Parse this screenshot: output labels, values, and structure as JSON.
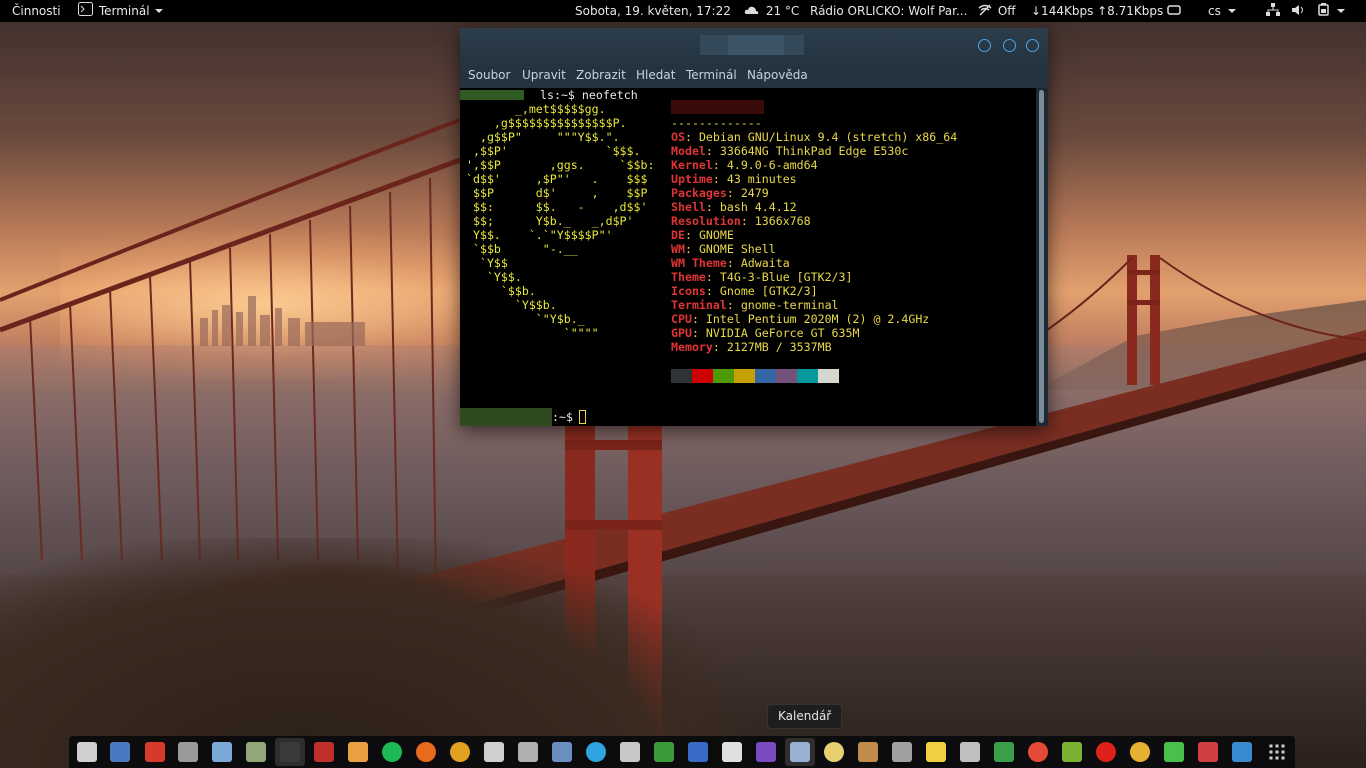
{
  "topbar": {
    "activities": "Činnosti",
    "app_menu": "Terminál",
    "clock": "Sobota, 19. květen, 17:22",
    "weather": "21 °C",
    "radio": "Rádio ORLICKO: Wolf Par...",
    "vpn": "Off",
    "netspeed": "↓144Kbps ↑8.71Kbps",
    "keyboard": "cs",
    "icons": [
      "terminal-icon",
      "chevron-down-icon",
      "cloud-sun-icon",
      "no-wifi-icon",
      "screen-icon",
      "network-icon",
      "volume-icon",
      "battery-icon",
      "power-menu-icon"
    ]
  },
  "terminal": {
    "menu": [
      "Soubor",
      "Upravit",
      "Zobrazit",
      "Hledat",
      "Terminál",
      "Nápověda"
    ],
    "command_line": "ls:~$ neofetch",
    "logo_lines": [
      "       _,met$$$$$gg.",
      "    ,g$$$$$$$$$$$$$$$P.",
      "  ,g$$P\"     \"\"\"Y$$.\".",
      " ,$$P'              `$$$.",
      "',$$P       ,ggs.     `$$b:",
      "`d$$'     ,$P\"'   .    $$$",
      " $$P      d$'     ,    $$P",
      " $$:      $$.   -    ,d$$'",
      " $$;      Y$b._   _,d$P'",
      " Y$$.    `.`\"Y$$$$P\"'",
      " `$$b      \"-.__",
      "  `Y$$",
      "   `Y$$.",
      "     `$$b.",
      "       `Y$$b.",
      "          `\"Y$b._",
      "              `\"\"\"\""
    ],
    "separator": "-------------",
    "info": [
      {
        "key": "OS",
        "value": "Debian GNU/Linux 9.4 (stretch) x86_64"
      },
      {
        "key": "Model",
        "value": "33664NG ThinkPad Edge E530c"
      },
      {
        "key": "Kernel",
        "value": "4.9.0-6-amd64"
      },
      {
        "key": "Uptime",
        "value": "43 minutes"
      },
      {
        "key": "Packages",
        "value": "2479"
      },
      {
        "key": "Shell",
        "value": "bash 4.4.12"
      },
      {
        "key": "Resolution",
        "value": "1366x768"
      },
      {
        "key": "DE",
        "value": "GNOME"
      },
      {
        "key": "WM",
        "value": "GNOME Shell"
      },
      {
        "key": "WM Theme",
        "value": "Adwaita"
      },
      {
        "key": "Theme",
        "value": "T4G-3-Blue [GTK2/3]"
      },
      {
        "key": "Icons",
        "value": "Gnome [GTK2/3]"
      },
      {
        "key": "Terminal",
        "value": "gnome-terminal"
      },
      {
        "key": "CPU",
        "value": "Intel Pentium 2020M (2) @ 2.4GHz"
      },
      {
        "key": "GPU",
        "value": "NVIDIA GeForce GT 635M"
      },
      {
        "key": "Memory",
        "value": "2127MB / 3537MB"
      }
    ],
    "palette": [
      "#2e3436",
      "#cc0000",
      "#4e9a06",
      "#c4a000",
      "#3465a4",
      "#75507b",
      "#06989a",
      "#d3d7cf"
    ],
    "prompt_suffix": ":~$"
  },
  "tooltip": "Kalendář",
  "dock": {
    "apps": [
      {
        "name": "files-icon",
        "color": "#cfcfcf"
      },
      {
        "name": "settings-icon",
        "color": "#4a78c0"
      },
      {
        "name": "dupeguru-icon",
        "color": "#d83a2a"
      },
      {
        "name": "system-tool-icon",
        "color": "#9a9a9a"
      },
      {
        "name": "screenshot-icon",
        "color": "#7aa8d8"
      },
      {
        "name": "calculator-icon",
        "color": "#8fa77a"
      },
      {
        "name": "terminal-icon",
        "color": "#3a3a3a"
      },
      {
        "name": "media-icon",
        "color": "#c0302a"
      },
      {
        "name": "text-editor-icon",
        "color": "#e8a040"
      },
      {
        "name": "spotify-icon",
        "color": "#1db954"
      },
      {
        "name": "firefox-icon",
        "color": "#e66b1e"
      },
      {
        "name": "chrome-icon",
        "color": "#e0a020"
      },
      {
        "name": "chat-icon",
        "color": "#d0d0d0"
      },
      {
        "name": "mail-icon",
        "color": "#b0b0b0"
      },
      {
        "name": "image-viewer-icon",
        "color": "#6a8ec0"
      },
      {
        "name": "telegram-icon",
        "color": "#2ca5e0"
      },
      {
        "name": "network-monitor-icon",
        "color": "#c8c8c8"
      },
      {
        "name": "spreadsheet-icon",
        "color": "#3a9a3a"
      },
      {
        "name": "document-icon",
        "color": "#3a6ac8"
      },
      {
        "name": "tor-icon",
        "color": "#e0e0e0"
      },
      {
        "name": "download-icon",
        "color": "#7a4ac0"
      },
      {
        "name": "calendar-icon",
        "color": "#9ab0d0"
      },
      {
        "name": "weather-icon",
        "color": "#e8d070"
      },
      {
        "name": "library-icon",
        "color": "#c08a4a"
      },
      {
        "name": "printer-icon",
        "color": "#a0a0a0"
      },
      {
        "name": "notes-icon",
        "color": "#f0d040"
      },
      {
        "name": "window-icon",
        "color": "#c0c0c0"
      },
      {
        "name": "system-monitor-icon",
        "color": "#3aa04a"
      },
      {
        "name": "help-icon",
        "color": "#e84a3a"
      },
      {
        "name": "game-icon",
        "color": "#7ab030"
      },
      {
        "name": "opera-icon",
        "color": "#e0201a"
      },
      {
        "name": "emoji-icon",
        "color": "#e8b030"
      },
      {
        "name": "tools-icon",
        "color": "#4ac04a"
      },
      {
        "name": "disk-icon",
        "color": "#d04040"
      },
      {
        "name": "chart-app-icon",
        "color": "#3a8ad0"
      },
      {
        "name": "app-grid-icon",
        "color": "#d0d0d0"
      }
    ]
  }
}
